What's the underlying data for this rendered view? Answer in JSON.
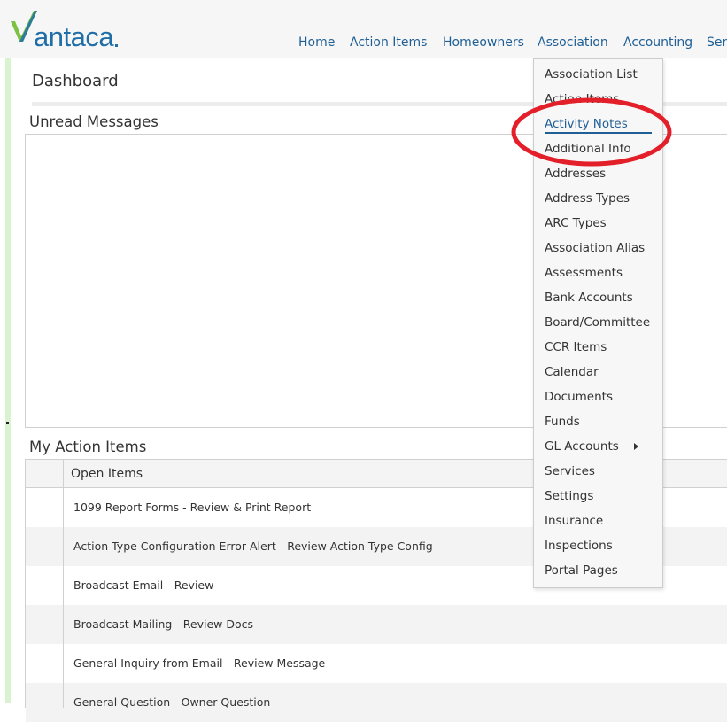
{
  "app": {
    "logo_text": "antaca",
    "logo_icon": "checkmark-v-icon",
    "brand_color": "#1f6ea8"
  },
  "nav": {
    "items": [
      "Home",
      "Action Items",
      "Homeowners",
      "Association",
      "Accounting",
      "Ser"
    ]
  },
  "dashboard": {
    "title": "Dashboard"
  },
  "unread_messages": {
    "title": "Unread Messages"
  },
  "action_items": {
    "title": "My Action Items",
    "header": "Open Items",
    "rows": [
      "1099 Report Forms - Review & Print Report",
      "Action Type Configuration Error Alert - Review Action Type Config",
      "Broadcast Email - Review",
      "Broadcast Mailing - Review Docs",
      "General Inquiry from Email - Review Message",
      "General Question - Owner Question"
    ]
  },
  "association_menu": {
    "items": [
      "Association List",
      "Action Items",
      "Activity Notes",
      "Additional Info",
      "Addresses",
      "Address Types",
      "ARC Types",
      "Association Alias",
      "Assessments",
      "Bank Accounts",
      "Board/Committee",
      "CCR Items",
      "Calendar",
      "Documents",
      "Funds",
      "GL Accounts",
      "Services",
      "Settings",
      "Insurance",
      "Inspections",
      "Portal Pages"
    ],
    "active_item": "Activity Notes",
    "highlight_color": "#e3202a"
  }
}
